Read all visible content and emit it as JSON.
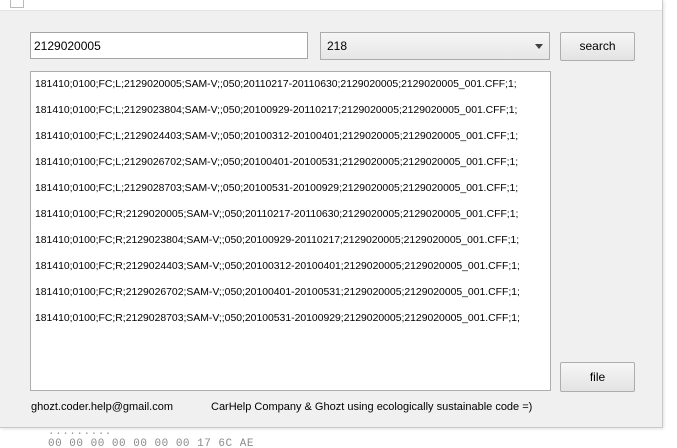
{
  "search": {
    "value": "2129020005"
  },
  "combo": {
    "selected": "218"
  },
  "buttons": {
    "search_label": "search",
    "file_label": "file"
  },
  "results": [
    "181410;0100;FC;L;2129020005;SAM-V;;050;20110217-20110630;2129020005;2129020005_001.CFF;1;",
    "181410;0100;FC;L;2129023804;SAM-V;;050;20100929-20110217;2129020005;2129020005_001.CFF;1;",
    "181410;0100;FC;L;2129024403;SAM-V;;050;20100312-20100401;2129020005;2129020005_001.CFF;1;",
    "181410;0100;FC;L;2129026702;SAM-V;;050;20100401-20100531;2129020005;2129020005_001.CFF;1;",
    "181410;0100;FC;L;2129028703;SAM-V;;050;20100531-20100929;2129020005;2129020005_001.CFF;1;",
    "181410;0100;FC;R;2129020005;SAM-V;;050;20110217-20110630;2129020005;2129020005_001.CFF;1;",
    "181410;0100;FC;R;2129023804;SAM-V;;050;20100929-20110217;2129020005;2129020005_001.CFF;1;",
    "181410;0100;FC;R;2129024403;SAM-V;;050;20100312-20100401;2129020005;2129020005_001.CFF;1;",
    "181410;0100;FC;R;2129026702;SAM-V;;050;20100401-20100531;2129020005;2129020005_001.CFF;1;",
    "181410;0100;FC;R;2129028703;SAM-V;;050;20100531-20100929;2129020005;2129020005_001.CFF;1;"
  ],
  "footer": {
    "email": "ghozt.coder.help@gmail.com",
    "note": "CarHelp Company & Ghozt using ecologically sustainable code =)"
  },
  "background": {
    "line1": ".........",
    "line2": "00 00 00 00 00 00 00 17 6C AE"
  },
  "colors": {
    "window_bg": "#f0f0f0",
    "input_border": "#a5a5a5",
    "button_border": "#adadad"
  }
}
